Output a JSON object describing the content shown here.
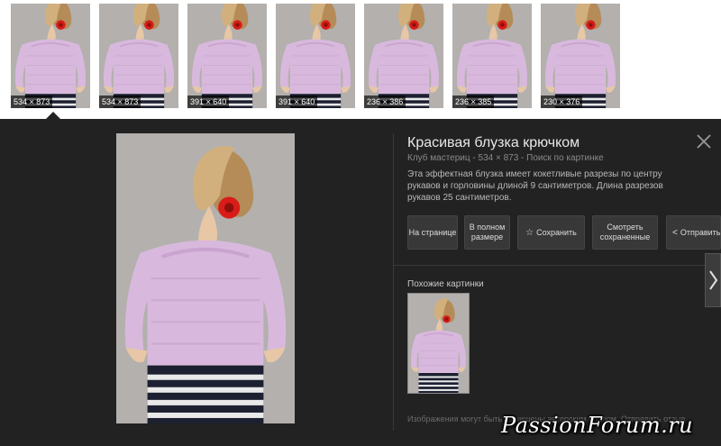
{
  "thumbnails": [
    {
      "size": "534 × 873"
    },
    {
      "size": "534 × 873"
    },
    {
      "size": "391 × 640"
    },
    {
      "size": "391 × 640"
    },
    {
      "size": "236 × 386"
    },
    {
      "size": "236 × 385"
    },
    {
      "size": "230 × 376"
    }
  ],
  "detail": {
    "title": "Красивая блузка крючком",
    "source": "Клуб мастериц",
    "separator": " - ",
    "dimensions": "534 × 873",
    "search_link": "Поиск по картинке",
    "description": "Эта эффектная блузка имеет кокетливые разрезы по центру рукавов и горловины длиной 9 сантиметров. Длина разрезов рукавов 25 сантиметров.",
    "buttons": {
      "on_page": "На странице",
      "full_size": "В полном размере",
      "save": "Сохранить",
      "view_saved": "Смотреть сохраненные",
      "share": "Отправить"
    },
    "similar_label": "Похожие картинки",
    "footer": "Изображения могут быть защищены авторским правом. Отправить отзыв"
  },
  "watermark": "PassionForum.ru",
  "colors": {
    "panel_bg": "#222222",
    "button_bg": "#383838",
    "blouse": "#d8b9dd"
  },
  "icons": [
    "star-icon",
    "share-icon",
    "close-icon",
    "chevron-right-icon"
  ]
}
